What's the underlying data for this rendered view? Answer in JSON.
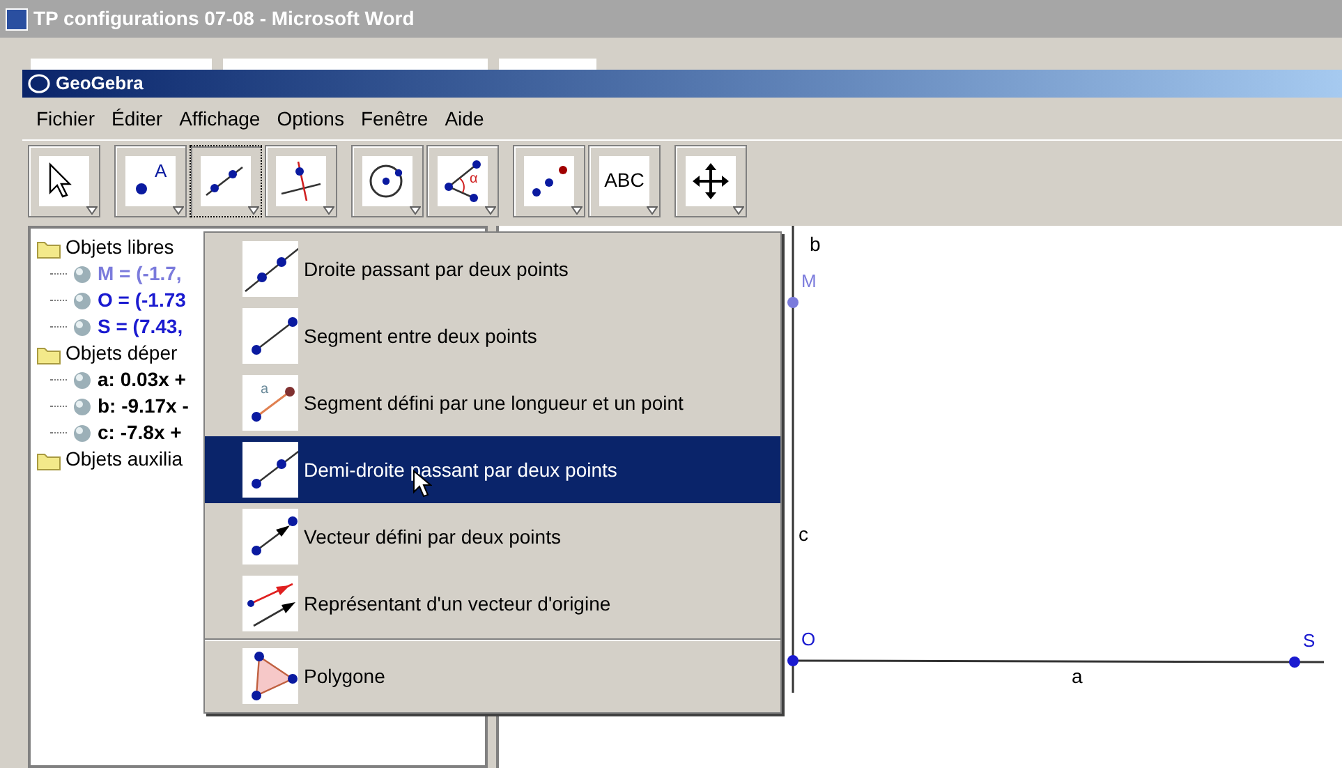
{
  "background_window": {
    "title": "TP configurations 07-08 - Microsoft Word"
  },
  "window": {
    "title": "GeoGebra"
  },
  "menu": [
    "Fichier",
    "Éditer",
    "Affichage",
    "Options",
    "Fenêtre",
    "Aide"
  ],
  "tool_groups": [
    {
      "tools": [
        {
          "selected": false
        }
      ]
    },
    {
      "tools": [
        {
          "selected": false,
          "label": "A"
        },
        {
          "selected": true
        },
        {
          "selected": false
        }
      ]
    },
    {
      "tools": [
        {
          "selected": false
        },
        {
          "selected": false,
          "label": "α"
        }
      ]
    },
    {
      "tools": [
        {
          "selected": false
        },
        {
          "selected": false,
          "label": "ABC"
        }
      ]
    },
    {
      "tools": [
        {
          "selected": false
        }
      ]
    }
  ],
  "algebra_tree": [
    {
      "label": "Objets libres",
      "children": [
        {
          "text": "M = (-1.7,",
          "color": "#7b7bdc"
        },
        {
          "text": "O = (-1.73",
          "color": "#1a1ad0"
        },
        {
          "text": "S = (7.43,",
          "color": "#1a1ad0"
        }
      ]
    },
    {
      "label": "Objets déper",
      "children": [
        {
          "text": "a: 0.03x +",
          "color": "#000000"
        },
        {
          "text": "b: -9.17x -",
          "color": "#000000"
        },
        {
          "text": "c: -7.8x +",
          "color": "#000000"
        }
      ]
    },
    {
      "label": "Objets auxilia"
    }
  ],
  "dropdown": [
    {
      "label": "Droite passant par deux points",
      "selected": false,
      "separator_before": false
    },
    {
      "label": "Segment entre deux points",
      "selected": false,
      "separator_before": false
    },
    {
      "label": "Segment défini par une longueur et un point",
      "selected": false,
      "separator_before": false,
      "icon_label": "a"
    },
    {
      "label": "Demi-droite passant par deux points",
      "selected": true,
      "separator_before": false
    },
    {
      "label": "Vecteur défini par deux points",
      "selected": false,
      "separator_before": false
    },
    {
      "label": "Représentant d'un vecteur d'origine",
      "selected": false,
      "separator_before": false
    },
    {
      "label": "Polygone",
      "selected": false,
      "separator_before": true
    }
  ],
  "graphics": {
    "line_labels": [
      "b",
      "c",
      "a"
    ],
    "points": [
      {
        "label": "M",
        "color": "#7b7bdc"
      },
      {
        "label": "O",
        "color": "#1a1ad0"
      },
      {
        "label": "S",
        "color": "#1a1ad0"
      }
    ]
  }
}
